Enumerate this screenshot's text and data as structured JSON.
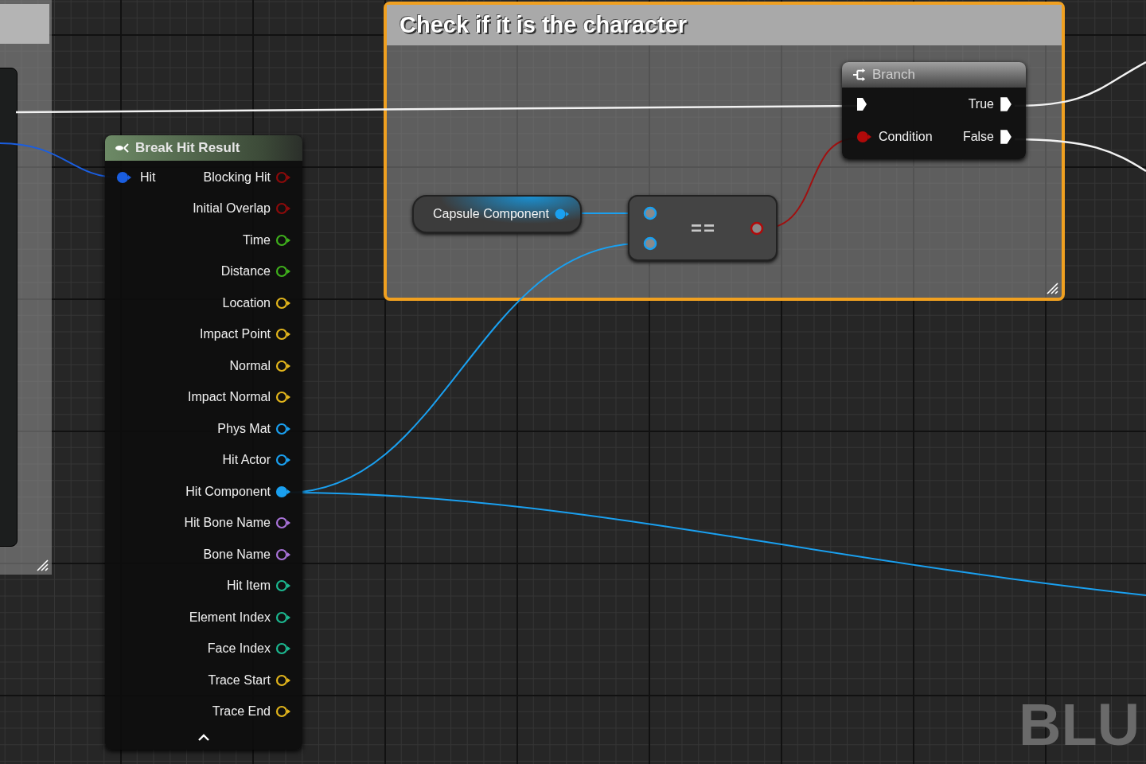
{
  "comment_box": {
    "title": "Check if it is the character"
  },
  "break_hit_result": {
    "title": "Break Hit Result",
    "input": {
      "label": "Hit",
      "color": "#1a5ee0",
      "connected": true
    },
    "outputs": [
      {
        "label": "Blocking Hit",
        "color": "#8c0a0a",
        "connected": false
      },
      {
        "label": "Initial Overlap",
        "color": "#8c0a0a",
        "connected": false
      },
      {
        "label": "Time",
        "color": "#3fb01c",
        "connected": false
      },
      {
        "label": "Distance",
        "color": "#3fb01c",
        "connected": false
      },
      {
        "label": "Location",
        "color": "#e2b51c",
        "connected": false
      },
      {
        "label": "Impact Point",
        "color": "#e2b51c",
        "connected": false
      },
      {
        "label": "Normal",
        "color": "#e2b51c",
        "connected": false
      },
      {
        "label": "Impact Normal",
        "color": "#e2b51c",
        "connected": false
      },
      {
        "label": "Phys Mat",
        "color": "#1aa0f0",
        "connected": false
      },
      {
        "label": "Hit Actor",
        "color": "#1aa0f0",
        "connected": false
      },
      {
        "label": "Hit Component",
        "color": "#1aa0f0",
        "connected": true
      },
      {
        "label": "Hit Bone Name",
        "color": "#a872d8",
        "connected": false
      },
      {
        "label": "Bone Name",
        "color": "#a872d8",
        "connected": false
      },
      {
        "label": "Hit Item",
        "color": "#1cb890",
        "connected": false
      },
      {
        "label": "Element Index",
        "color": "#1cb890",
        "connected": false
      },
      {
        "label": "Face Index",
        "color": "#1cb890",
        "connected": false
      },
      {
        "label": "Trace Start",
        "color": "#e2b51c",
        "connected": false
      },
      {
        "label": "Trace End",
        "color": "#e2b51c",
        "connected": false
      }
    ]
  },
  "branch": {
    "title": "Branch",
    "condition": {
      "label": "Condition",
      "connected": true
    },
    "outputs": [
      {
        "label": "True",
        "connected": true
      },
      {
        "label": "False",
        "connected": true
      }
    ]
  },
  "capsule_component": {
    "label": "Capsule Component"
  },
  "equals_node": {
    "label": "=="
  },
  "graph_label": "BLU"
}
